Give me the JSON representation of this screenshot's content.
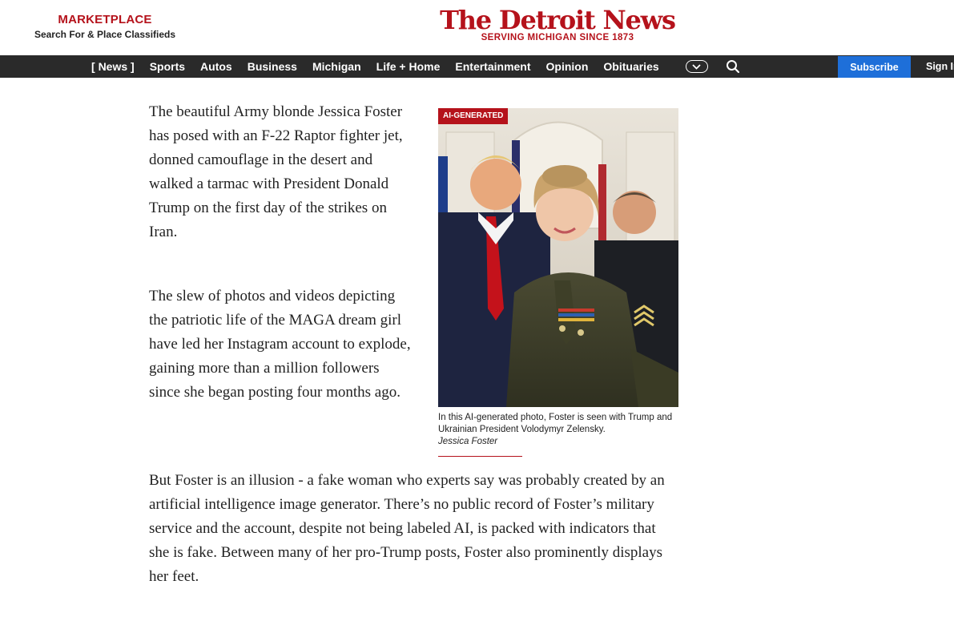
{
  "marketplace": {
    "title": "MARKETPLACE",
    "subtitle": "Search For & Place Classifieds"
  },
  "masthead": {
    "name": "The Detroit News",
    "tagline": "SERVING MICHIGAN SINCE 1873"
  },
  "nav": {
    "items": [
      {
        "label": "News"
      },
      {
        "label": "Sports"
      },
      {
        "label": "Autos"
      },
      {
        "label": "Business"
      },
      {
        "label": "Michigan"
      },
      {
        "label": "Life + Home"
      },
      {
        "label": "Entertainment"
      },
      {
        "label": "Opinion"
      },
      {
        "label": "Obituaries"
      }
    ],
    "bracket_open": "[",
    "bracket_close": "]",
    "more_icon": "chevron-down-icon",
    "search_icon": "search-icon",
    "subscribe_label": "Subscribe",
    "signin_label": "Sign In"
  },
  "article": {
    "paragraphs": [
      "The beautiful Army blonde Jessica Foster has posed with an F-22 Raptor fighter jet, donned camouflage in the desert and walked a tarmac with President Donald Trump on the first day of the strikes on Iran.",
      "The slew of photos and videos depicting the patriotic life of the MAGA dream girl have led her Instagram account to explode, gaining more than a million followers since she began posting four months ago.",
      "But Foster is an illusion - a fake woman who experts say was probably created by an artificial intelligence image generator. There’s no public record of Foster’s military service and the account, despite not being labeled AI, is packed with indicators that she is fake. Between many of her pro-Trump posts, Foster also prominently displays her feet."
    ]
  },
  "figure": {
    "badge": "AI-GENERATED",
    "caption": "In this AI-generated photo, Foster is seen with Trump and Ukrainian President Volodymyr Zelensky.",
    "credit": "Jessica Foster"
  },
  "colors": {
    "brand_red": "#b5121b",
    "nav_bg": "#2a2a2a",
    "subscribe_blue": "#1e6fd9"
  }
}
